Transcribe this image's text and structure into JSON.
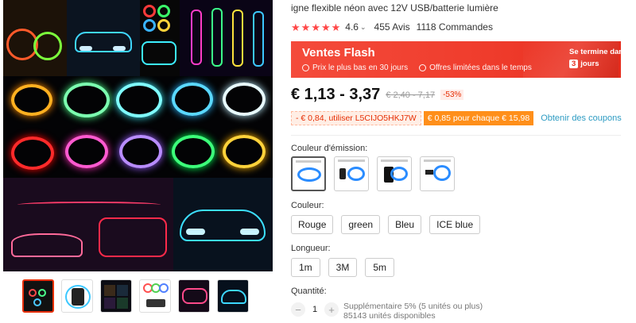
{
  "product": {
    "title": "igne flexible néon avec 12V USB/batterie lumière",
    "rating": "4.6",
    "reviews": "455 Avis",
    "orders": "1118 Commandes",
    "stars": 5
  },
  "flash_sale": {
    "title": "Ventes Flash",
    "badge1": "Prix le plus bas en 30 jours",
    "badge2": "Offres limitées dans le temps",
    "ends_label": "Se termine dan",
    "days_value": "3",
    "days_label": "jours"
  },
  "price": {
    "current": "€ 1,13 - 3,37",
    "original": "€ 2,40 - 7,17",
    "discount": "-53%"
  },
  "coupons": {
    "code_coupon": "- € 0,84, utiliser L5CIJO5HKJ7W",
    "store_coupon": "€ 0,85 pour chaque € 15,98",
    "link": "Obtenir des coupons"
  },
  "emission_color": {
    "label": "Couleur d'émission:"
  },
  "color": {
    "label": "Couleur:",
    "options": [
      "Rouge",
      "green",
      "Bleu",
      "ICE blue"
    ]
  },
  "length": {
    "label": "Longueur:",
    "options": [
      "1m",
      "3M",
      "5m"
    ]
  },
  "quantity": {
    "label": "Quantité:",
    "value": "1",
    "minus": "−",
    "plus": "+",
    "info_line1": "Supplémentaire 5% (5 unités ou plus)",
    "info_line2": "85143 unités disponibles"
  },
  "icons": {
    "star": "star-icon",
    "chevron": "chevron-down-icon",
    "price_tag": "tag-icon",
    "clock": "clock-icon"
  },
  "colors": {
    "accent": "#ff4747",
    "flash_bg": "#ef3c2c",
    "coupon_orange": "#ff8f1a",
    "link_blue": "#2e9cc3"
  }
}
